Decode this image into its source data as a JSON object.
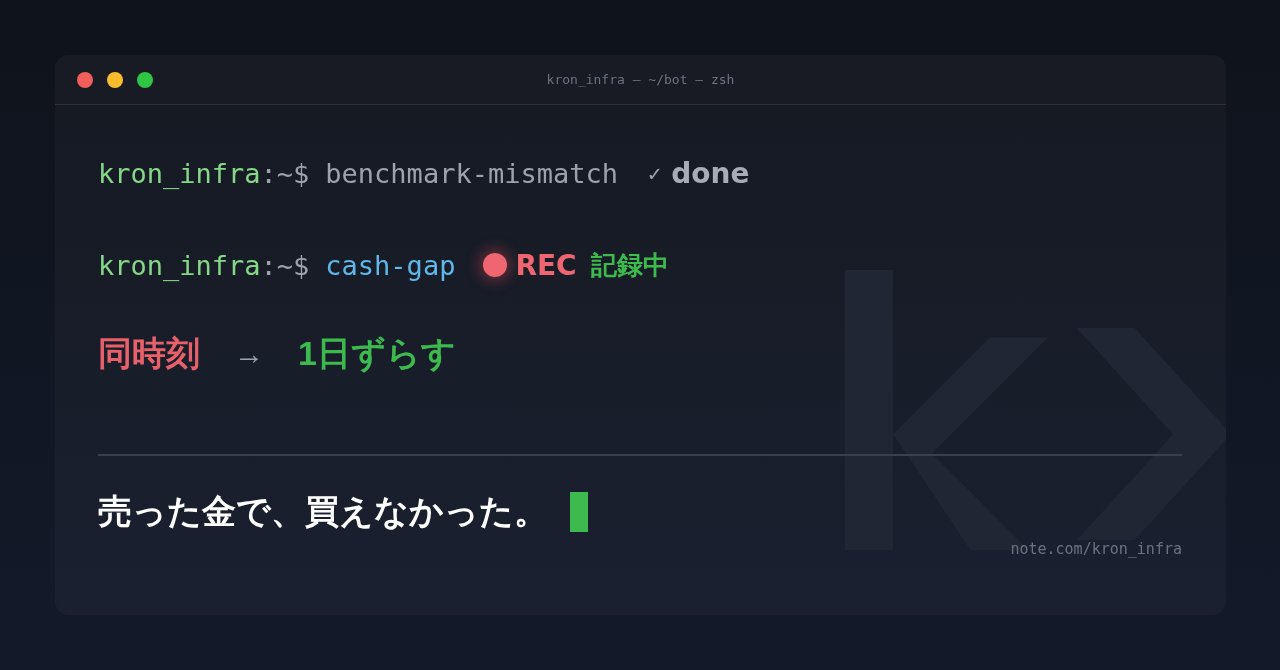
{
  "window": {
    "title": "kron_infra — ~/bot — zsh"
  },
  "lines": [
    {
      "kind": "done",
      "user": "kron_infra",
      "path": ":~$",
      "command": "benchmark-mismatch",
      "mark": "✓",
      "status": "done"
    },
    {
      "kind": "running",
      "user": "kron_infra",
      "path": ":~$",
      "command": "cash-gap",
      "recording": true,
      "rec_label": "REC",
      "rec_note": "記録中"
    }
  ],
  "transition": {
    "from": "同時刻",
    "arrow": "→",
    "to": "1日ずらす"
  },
  "headline": "売った金で、買えなかった。",
  "cursor_visible": true,
  "footer": "note.com/kron_infra"
}
